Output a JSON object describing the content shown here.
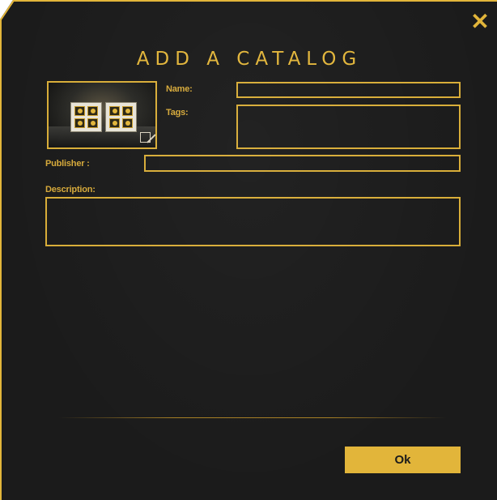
{
  "dialog": {
    "title": "ADD A CATALOG",
    "close_icon": "close-icon",
    "accent_color": "#e2b53a",
    "background_color": "#1b1b1b"
  },
  "thumbnail": {
    "image_icon": "catalog-thumbnail-image",
    "edit_icon": "edit-icon"
  },
  "form": {
    "name_label": "Name:",
    "name_value": "",
    "tags_label": "Tags:",
    "tags_value": "",
    "publisher_label": "Publisher :",
    "publisher_value": "",
    "description_label": "Description:",
    "description_value": ""
  },
  "actions": {
    "ok_label": "Ok"
  }
}
